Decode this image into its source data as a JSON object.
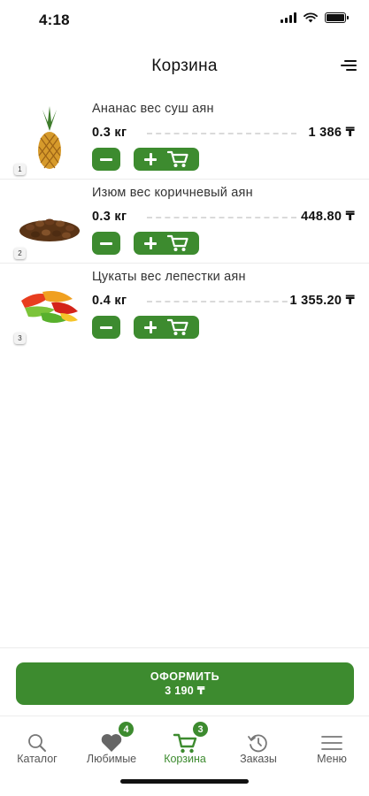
{
  "status_bar": {
    "time": "4:18"
  },
  "header": {
    "title": "Корзина"
  },
  "cart": {
    "items": [
      {
        "index": "1",
        "name": "Ананас вес суш аян",
        "qty": "0.3 кг",
        "price": "1 386 ₸"
      },
      {
        "index": "2",
        "name": "Изюм вес коричневый аян",
        "qty": "0.3 кг",
        "price": "448.80 ₸"
      },
      {
        "index": "3",
        "name": "Цукаты вес лепестки аян",
        "qty": "0.4 кг",
        "price": "1 355.20 ₸"
      }
    ]
  },
  "checkout": {
    "label": "ОФОРМИТЬ",
    "total": "3 190 ₸"
  },
  "tabs": [
    {
      "label": "Каталог",
      "icon": "search-icon"
    },
    {
      "label": "Любимые",
      "icon": "heart-icon",
      "badge": "4"
    },
    {
      "label": "Корзина",
      "icon": "cart-icon",
      "badge": "3",
      "active": true
    },
    {
      "label": "Заказы",
      "icon": "history-icon"
    },
    {
      "label": "Меню",
      "icon": "menu-icon"
    }
  ],
  "colors": {
    "accent": "#3d8b2f",
    "text": "#111111",
    "muted": "#555555"
  }
}
